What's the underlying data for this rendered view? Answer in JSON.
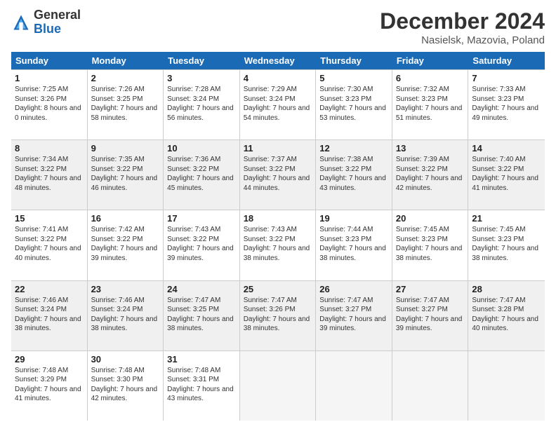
{
  "logo": {
    "general": "General",
    "blue": "Blue"
  },
  "title": "December 2024",
  "subtitle": "Nasielsk, Mazovia, Poland",
  "days": [
    "Sunday",
    "Monday",
    "Tuesday",
    "Wednesday",
    "Thursday",
    "Friday",
    "Saturday"
  ],
  "weeks": [
    [
      {
        "day": "1",
        "sunrise": "Sunrise: 7:25 AM",
        "sunset": "Sunset: 3:26 PM",
        "daylight": "Daylight: 8 hours and 0 minutes.",
        "shaded": false
      },
      {
        "day": "2",
        "sunrise": "Sunrise: 7:26 AM",
        "sunset": "Sunset: 3:25 PM",
        "daylight": "Daylight: 7 hours and 58 minutes.",
        "shaded": false
      },
      {
        "day": "3",
        "sunrise": "Sunrise: 7:28 AM",
        "sunset": "Sunset: 3:24 PM",
        "daylight": "Daylight: 7 hours and 56 minutes.",
        "shaded": false
      },
      {
        "day": "4",
        "sunrise": "Sunrise: 7:29 AM",
        "sunset": "Sunset: 3:24 PM",
        "daylight": "Daylight: 7 hours and 54 minutes.",
        "shaded": false
      },
      {
        "day": "5",
        "sunrise": "Sunrise: 7:30 AM",
        "sunset": "Sunset: 3:23 PM",
        "daylight": "Daylight: 7 hours and 53 minutes.",
        "shaded": false
      },
      {
        "day": "6",
        "sunrise": "Sunrise: 7:32 AM",
        "sunset": "Sunset: 3:23 PM",
        "daylight": "Daylight: 7 hours and 51 minutes.",
        "shaded": false
      },
      {
        "day": "7",
        "sunrise": "Sunrise: 7:33 AM",
        "sunset": "Sunset: 3:23 PM",
        "daylight": "Daylight: 7 hours and 49 minutes.",
        "shaded": false
      }
    ],
    [
      {
        "day": "8",
        "sunrise": "Sunrise: 7:34 AM",
        "sunset": "Sunset: 3:22 PM",
        "daylight": "Daylight: 7 hours and 48 minutes.",
        "shaded": true
      },
      {
        "day": "9",
        "sunrise": "Sunrise: 7:35 AM",
        "sunset": "Sunset: 3:22 PM",
        "daylight": "Daylight: 7 hours and 46 minutes.",
        "shaded": true
      },
      {
        "day": "10",
        "sunrise": "Sunrise: 7:36 AM",
        "sunset": "Sunset: 3:22 PM",
        "daylight": "Daylight: 7 hours and 45 minutes.",
        "shaded": true
      },
      {
        "day": "11",
        "sunrise": "Sunrise: 7:37 AM",
        "sunset": "Sunset: 3:22 PM",
        "daylight": "Daylight: 7 hours and 44 minutes.",
        "shaded": true
      },
      {
        "day": "12",
        "sunrise": "Sunrise: 7:38 AM",
        "sunset": "Sunset: 3:22 PM",
        "daylight": "Daylight: 7 hours and 43 minutes.",
        "shaded": true
      },
      {
        "day": "13",
        "sunrise": "Sunrise: 7:39 AM",
        "sunset": "Sunset: 3:22 PM",
        "daylight": "Daylight: 7 hours and 42 minutes.",
        "shaded": true
      },
      {
        "day": "14",
        "sunrise": "Sunrise: 7:40 AM",
        "sunset": "Sunset: 3:22 PM",
        "daylight": "Daylight: 7 hours and 41 minutes.",
        "shaded": true
      }
    ],
    [
      {
        "day": "15",
        "sunrise": "Sunrise: 7:41 AM",
        "sunset": "Sunset: 3:22 PM",
        "daylight": "Daylight: 7 hours and 40 minutes.",
        "shaded": false
      },
      {
        "day": "16",
        "sunrise": "Sunrise: 7:42 AM",
        "sunset": "Sunset: 3:22 PM",
        "daylight": "Daylight: 7 hours and 39 minutes.",
        "shaded": false
      },
      {
        "day": "17",
        "sunrise": "Sunrise: 7:43 AM",
        "sunset": "Sunset: 3:22 PM",
        "daylight": "Daylight: 7 hours and 39 minutes.",
        "shaded": false
      },
      {
        "day": "18",
        "sunrise": "Sunrise: 7:43 AM",
        "sunset": "Sunset: 3:22 PM",
        "daylight": "Daylight: 7 hours and 38 minutes.",
        "shaded": false
      },
      {
        "day": "19",
        "sunrise": "Sunrise: 7:44 AM",
        "sunset": "Sunset: 3:23 PM",
        "daylight": "Daylight: 7 hours and 38 minutes.",
        "shaded": false
      },
      {
        "day": "20",
        "sunrise": "Sunrise: 7:45 AM",
        "sunset": "Sunset: 3:23 PM",
        "daylight": "Daylight: 7 hours and 38 minutes.",
        "shaded": false
      },
      {
        "day": "21",
        "sunrise": "Sunrise: 7:45 AM",
        "sunset": "Sunset: 3:23 PM",
        "daylight": "Daylight: 7 hours and 38 minutes.",
        "shaded": false
      }
    ],
    [
      {
        "day": "22",
        "sunrise": "Sunrise: 7:46 AM",
        "sunset": "Sunset: 3:24 PM",
        "daylight": "Daylight: 7 hours and 38 minutes.",
        "shaded": true
      },
      {
        "day": "23",
        "sunrise": "Sunrise: 7:46 AM",
        "sunset": "Sunset: 3:24 PM",
        "daylight": "Daylight: 7 hours and 38 minutes.",
        "shaded": true
      },
      {
        "day": "24",
        "sunrise": "Sunrise: 7:47 AM",
        "sunset": "Sunset: 3:25 PM",
        "daylight": "Daylight: 7 hours and 38 minutes.",
        "shaded": true
      },
      {
        "day": "25",
        "sunrise": "Sunrise: 7:47 AM",
        "sunset": "Sunset: 3:26 PM",
        "daylight": "Daylight: 7 hours and 38 minutes.",
        "shaded": true
      },
      {
        "day": "26",
        "sunrise": "Sunrise: 7:47 AM",
        "sunset": "Sunset: 3:27 PM",
        "daylight": "Daylight: 7 hours and 39 minutes.",
        "shaded": true
      },
      {
        "day": "27",
        "sunrise": "Sunrise: 7:47 AM",
        "sunset": "Sunset: 3:27 PM",
        "daylight": "Daylight: 7 hours and 39 minutes.",
        "shaded": true
      },
      {
        "day": "28",
        "sunrise": "Sunrise: 7:47 AM",
        "sunset": "Sunset: 3:28 PM",
        "daylight": "Daylight: 7 hours and 40 minutes.",
        "shaded": true
      }
    ],
    [
      {
        "day": "29",
        "sunrise": "Sunrise: 7:48 AM",
        "sunset": "Sunset: 3:29 PM",
        "daylight": "Daylight: 7 hours and 41 minutes.",
        "shaded": false
      },
      {
        "day": "30",
        "sunrise": "Sunrise: 7:48 AM",
        "sunset": "Sunset: 3:30 PM",
        "daylight": "Daylight: 7 hours and 42 minutes.",
        "shaded": false
      },
      {
        "day": "31",
        "sunrise": "Sunrise: 7:48 AM",
        "sunset": "Sunset: 3:31 PM",
        "daylight": "Daylight: 7 hours and 43 minutes.",
        "shaded": false
      },
      {
        "day": "",
        "sunrise": "",
        "sunset": "",
        "daylight": "",
        "empty": true,
        "shaded": false
      },
      {
        "day": "",
        "sunrise": "",
        "sunset": "",
        "daylight": "",
        "empty": true,
        "shaded": false
      },
      {
        "day": "",
        "sunrise": "",
        "sunset": "",
        "daylight": "",
        "empty": true,
        "shaded": false
      },
      {
        "day": "",
        "sunrise": "",
        "sunset": "",
        "daylight": "",
        "empty": true,
        "shaded": false
      }
    ]
  ]
}
